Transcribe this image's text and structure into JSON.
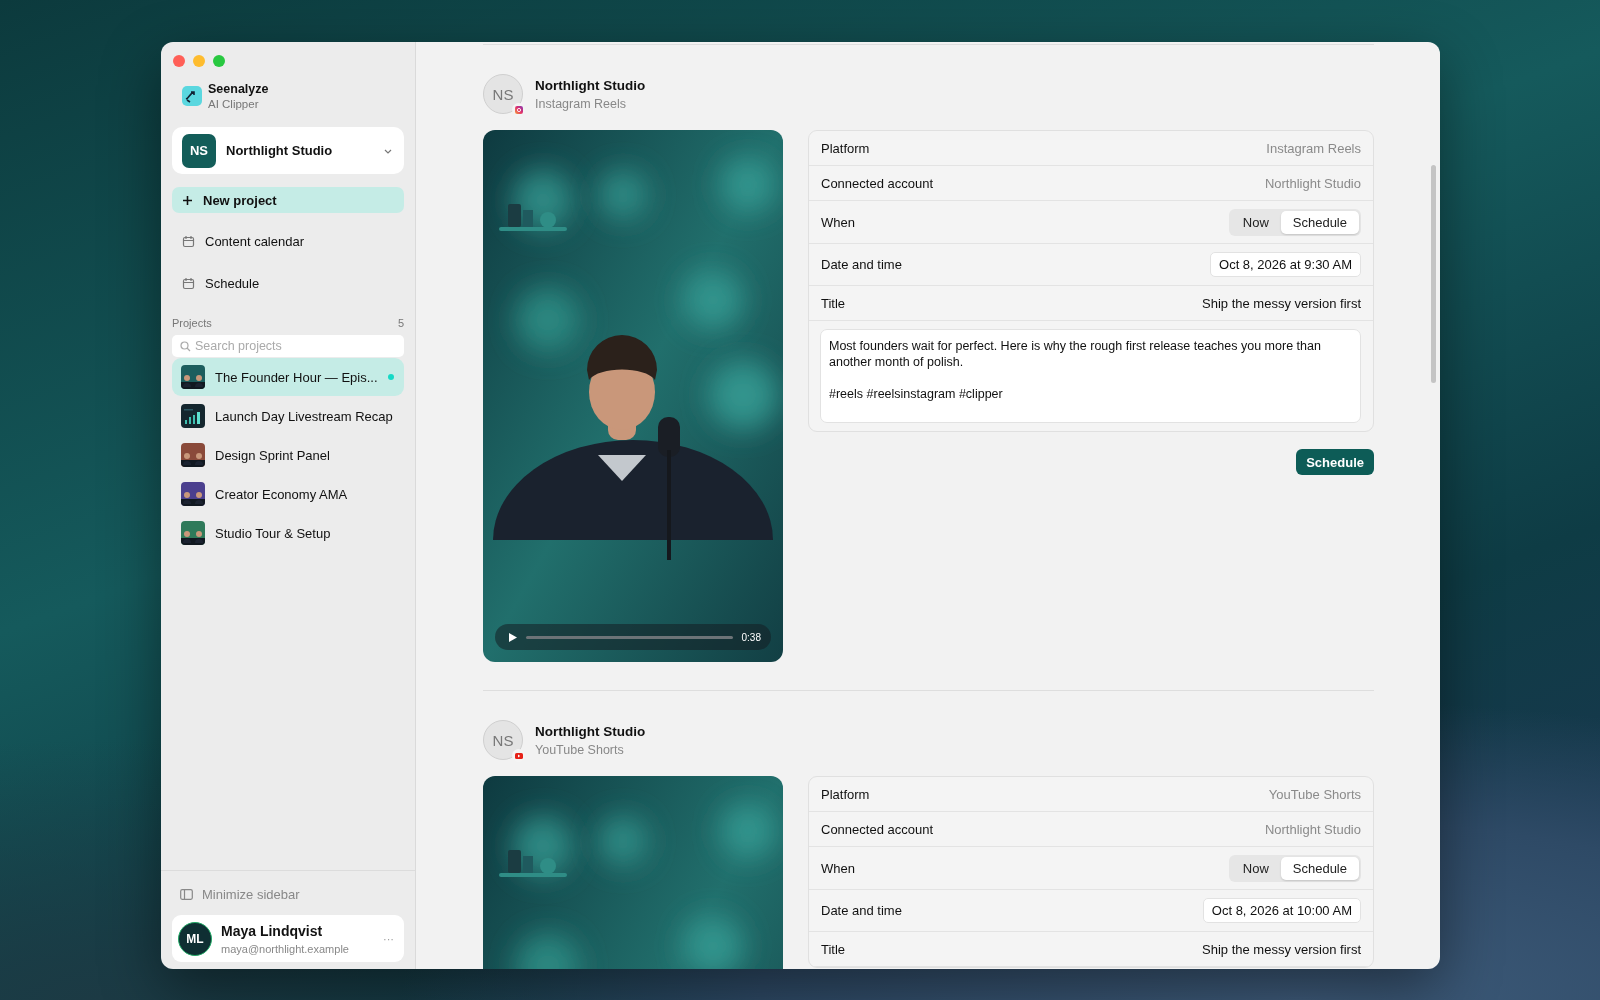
{
  "app": {
    "name": "Seenalyze",
    "subtitle": "AI Clipper"
  },
  "workspace": {
    "initials": "NS",
    "name": "Northlight Studio"
  },
  "nav": [
    {
      "label": "New project",
      "kind": "primary"
    },
    {
      "label": "Content calendar",
      "kind": "calendar"
    },
    {
      "label": "Schedule",
      "kind": "schedule"
    }
  ],
  "projects": {
    "title": "Projects",
    "count": "5",
    "search": {
      "placeholder": "Search projects"
    },
    "items": [
      {
        "name": "The Founder Hour — Epis...",
        "selected": true,
        "indicator": true,
        "kind": "people",
        "color": "#1d5e5e"
      },
      {
        "name": "Launch Day Livestream Recap",
        "selected": false,
        "indicator": false,
        "kind": "chart",
        "color": "#14262e"
      },
      {
        "name": "Design Sprint Panel",
        "selected": false,
        "indicator": false,
        "kind": "people",
        "color": "#8a4a3a"
      },
      {
        "name": "Creator Economy AMA",
        "selected": false,
        "indicator": false,
        "kind": "people",
        "color": "#4b3f8e"
      },
      {
        "name": "Studio Tour & Setup",
        "selected": false,
        "indicator": false,
        "kind": "people",
        "color": "#2f7a5a"
      }
    ]
  },
  "minimize": {
    "label": "Minimize sidebar"
  },
  "user": {
    "initials": "ML",
    "name": "Maya Lindqvist",
    "email": "maya@northlight.example",
    "menu": "···"
  },
  "posts": [
    {
      "initials": "NS",
      "account": "Northlight Studio",
      "platform": "Instagram Reels",
      "badge": {
        "kind": "instagram"
      },
      "video": {
        "duration": "0:38"
      },
      "details": [
        {
          "label": "Platform",
          "kind": "muted",
          "value": "Instagram Reels"
        },
        {
          "label": "Connected account",
          "kind": "muted",
          "value": "Northlight Studio"
        },
        {
          "label": "When",
          "kind": "segmented",
          "options": [
            {
              "label": "Now",
              "selected": false
            },
            {
              "label": "Schedule",
              "selected": true
            }
          ]
        },
        {
          "label": "Date and time",
          "kind": "field",
          "value": "Oct 8, 2026 at 9:30 AM"
        },
        {
          "label": "Title",
          "kind": "text",
          "value": "Ship the messy version first"
        }
      ],
      "caption": "Most founders wait for perfect. Here is why the rough first release teaches you more than another month of polish.\n\n#reels #reelsinstagram #clipper",
      "action": "Schedule"
    },
    {
      "initials": "NS",
      "account": "Northlight Studio",
      "platform": "YouTube Shorts",
      "badge": {
        "kind": "youtube"
      },
      "details": [
        {
          "label": "Platform",
          "kind": "muted",
          "value": "YouTube Shorts"
        },
        {
          "label": "Connected account",
          "kind": "muted",
          "value": "Northlight Studio"
        },
        {
          "label": "When",
          "kind": "segmented",
          "options": [
            {
              "label": "Now",
              "selected": false
            },
            {
              "label": "Schedule",
              "selected": true
            }
          ]
        },
        {
          "label": "Date and time",
          "kind": "field",
          "value": "Oct 8, 2026 at 10:00 AM"
        },
        {
          "label": "Title",
          "kind": "text",
          "value": "Ship the messy version first"
        }
      ]
    }
  ]
}
